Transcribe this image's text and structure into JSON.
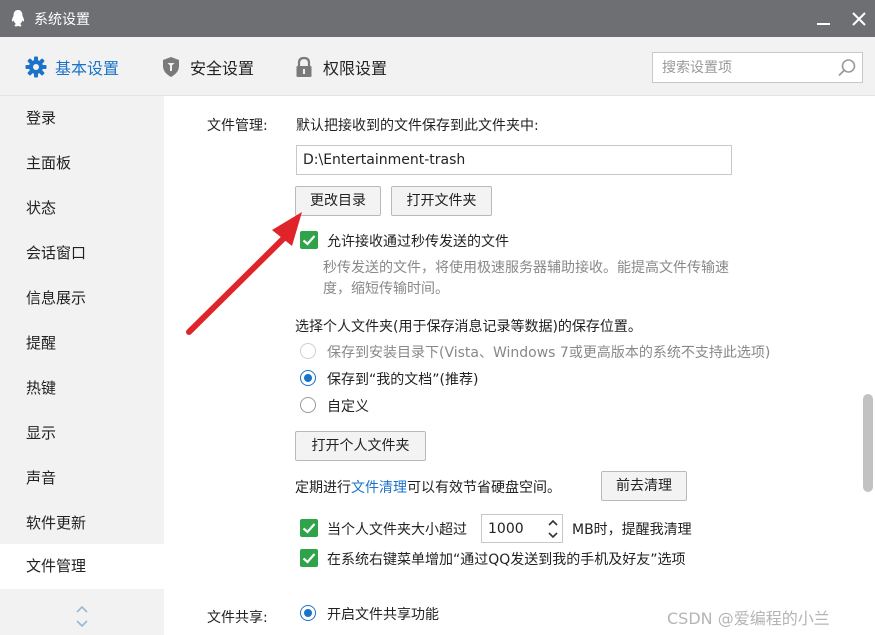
{
  "window": {
    "title": "系统设置"
  },
  "tabs": [
    {
      "label": "基本设置",
      "icon": "gear-icon",
      "active": true
    },
    {
      "label": "安全设置",
      "icon": "shield-icon",
      "active": false
    },
    {
      "label": "权限设置",
      "icon": "lock-icon",
      "active": false
    }
  ],
  "search": {
    "placeholder": "搜索设置项"
  },
  "sidebar": {
    "items": [
      {
        "label": "登录"
      },
      {
        "label": "主面板"
      },
      {
        "label": "状态"
      },
      {
        "label": "会话窗口"
      },
      {
        "label": "信息展示"
      },
      {
        "label": "提醒"
      },
      {
        "label": "热键"
      },
      {
        "label": "显示"
      },
      {
        "label": "声音"
      },
      {
        "label": "软件更新"
      },
      {
        "label": "文件管理",
        "active": true
      }
    ]
  },
  "file_management": {
    "section_label": "文件管理:",
    "save_desc": "默认把接收到的文件保存到此文件夹中:",
    "path_value": "D:\\Entertainment-trash",
    "change_dir_button": "更改目录",
    "open_folder_button": "打开文件夹",
    "flash_transfer_label": "允许接收通过秒传发送的文件",
    "flash_transfer_desc_1": "秒传发送的文件，将使用极速服务器辅助接收。能提高文件传输速",
    "flash_transfer_desc_2": "度，缩短传输时间。",
    "personal_folder_desc": "选择个人文件夹(用于保存消息记录等数据)的保存位置。",
    "radio_install_dir": "保存到安装目录下(Vista、Windows 7或更高版本的系统不支持此选项)",
    "radio_my_documents": "保存到“我的文档”(推荐)",
    "radio_custom": "自定义",
    "open_personal_folder_button": "打开个人文件夹",
    "cleanup_prefix": "定期进行",
    "cleanup_link": "文件清理",
    "cleanup_suffix": "可以有效节省硬盘空间。",
    "go_cleanup_button": "前去清理",
    "size_warn_prefix": "当个人文件夹大小超过",
    "size_warn_value": "1000",
    "size_warn_suffix": "MB时，提醒我清理",
    "context_menu_label": "在系统右键菜单增加“通过QQ发送到我的手机及好友”选项"
  },
  "file_sharing": {
    "section_label": "文件共享:",
    "enable_label": "开启文件共享功能"
  },
  "watermark": "CSDN @爱编程的小兰",
  "colors": {
    "accent": "#1a73c8",
    "checkbox_green": "#2fa34a",
    "annotation_arrow": "#e0252a",
    "titlebar": "#6d6f72"
  }
}
